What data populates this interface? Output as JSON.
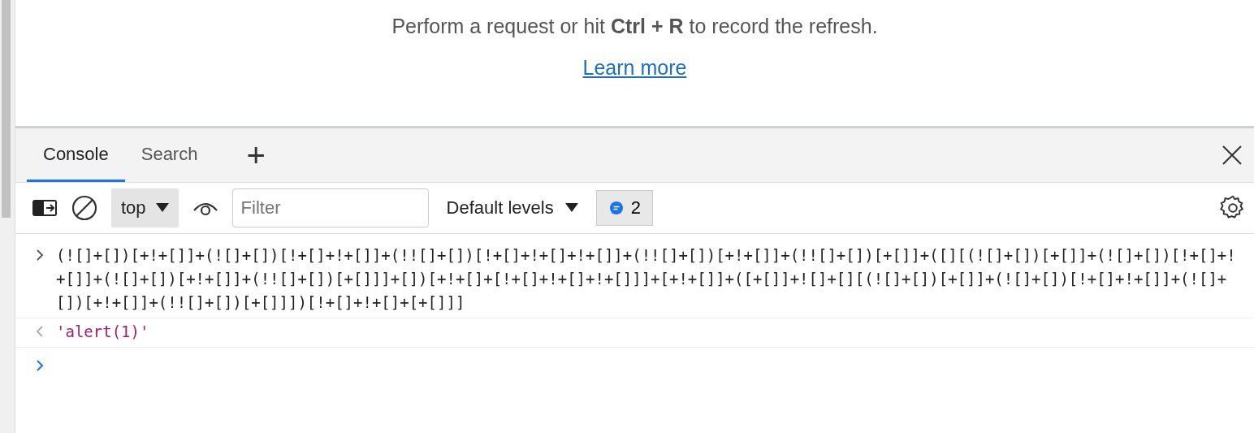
{
  "network_hint": {
    "message": "Perform a request or hit **Ctrl + R** to record the refresh.",
    "link": "Learn more"
  },
  "tabs": [
    {
      "label": "Console",
      "selected": true
    },
    {
      "label": "Search",
      "selected": false
    }
  ],
  "add_tab": "+",
  "toolbar": {
    "context": "top",
    "filter": {
      "placeholder": "Filter"
    },
    "levels": "Default levels",
    "message_count": "2"
  },
  "console": [
    {
      "kind": "input",
      "text": "(![]+[])[+!+[]]+(![]+[])[!+[]+!+[]]+(!![]+[])[!+[]+!+[]+!+[]]+(!![]+[])[+!+[]]+(!![]+[])[+[]]+([][(![]+[])[+[]]+(![]+[])[!+[]+!+[]]+(![]+[])[+!+[]]+(!![]+[])[+[]]]+[])[+!+[]+[!+[]+!+[]+!+[]]]+[+!+[]]+([+[]]+![]+[][(![]+[])[+[]]+(![]+[])[!+[]+!+[]]+(![]+[])[+!+[]]+(!![]+[])[+[]]])[!+[]+!+[]+[+[]]]"
    },
    {
      "kind": "result",
      "text": "'alert(1)'"
    }
  ]
}
